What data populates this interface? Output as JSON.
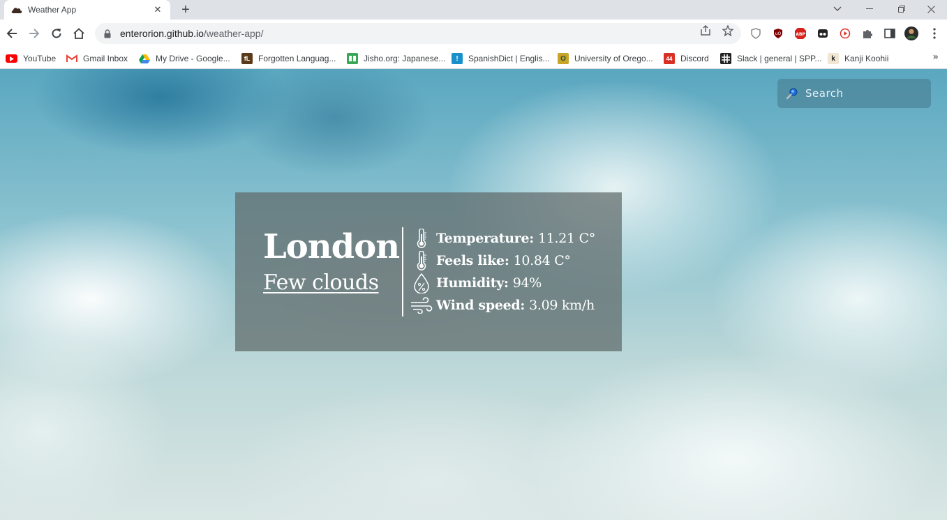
{
  "browser": {
    "tab_title": "Weather App",
    "url_host": "enterorion.github.io",
    "url_path": "/weather-app/",
    "new_tab": "+",
    "bookmarks": [
      {
        "label": "YouTube",
        "icon": "youtube-icon",
        "color": "#ff0000"
      },
      {
        "label": "Gmail Inbox",
        "icon": "gmail-icon",
        "color": "#ea4335"
      },
      {
        "label": "My Drive - Google...",
        "icon": "drive-icon",
        "color": "#fbbc04"
      },
      {
        "label": "Forgotten Languag...",
        "icon": "fl-icon",
        "color": "#5a3a1a"
      },
      {
        "label": "Jisho.org: Japanese...",
        "icon": "jisho-icon",
        "color": "#3aa757"
      },
      {
        "label": "SpanishDict | Englis...",
        "icon": "spanishdict-icon",
        "color": "#1a8fc9"
      },
      {
        "label": "University of Orego...",
        "icon": "uo-icon",
        "color": "#c8a428"
      },
      {
        "label": "Discord",
        "icon": "discord-icon",
        "color": "#d93025"
      },
      {
        "label": "Slack | general | SPP...",
        "icon": "slack-icon",
        "color": "#222222"
      },
      {
        "label": "Kanji Koohii",
        "icon": "koohii-icon",
        "color": "#f0e6d2"
      }
    ],
    "bookmarks_more": "»"
  },
  "search": {
    "placeholder": "Search"
  },
  "weather": {
    "city": "London",
    "description": "Few clouds",
    "stats": [
      {
        "label": "Temperature:",
        "value": "11.21 C°",
        "icon": "thermometer-icon"
      },
      {
        "label": "Feels like:",
        "value": "10.84 C°",
        "icon": "thermometer-icon"
      },
      {
        "label": "Humidity:",
        "value": "94%",
        "icon": "humidity-drop-icon"
      },
      {
        "label": "Wind speed:",
        "value": "3.09 km/h",
        "icon": "wind-icon"
      }
    ]
  },
  "colors": {
    "card_bg": "rgba(95,105,105,0.72)",
    "search_bg": "rgba(70,120,140,0.55)",
    "text": "#ffffff"
  }
}
